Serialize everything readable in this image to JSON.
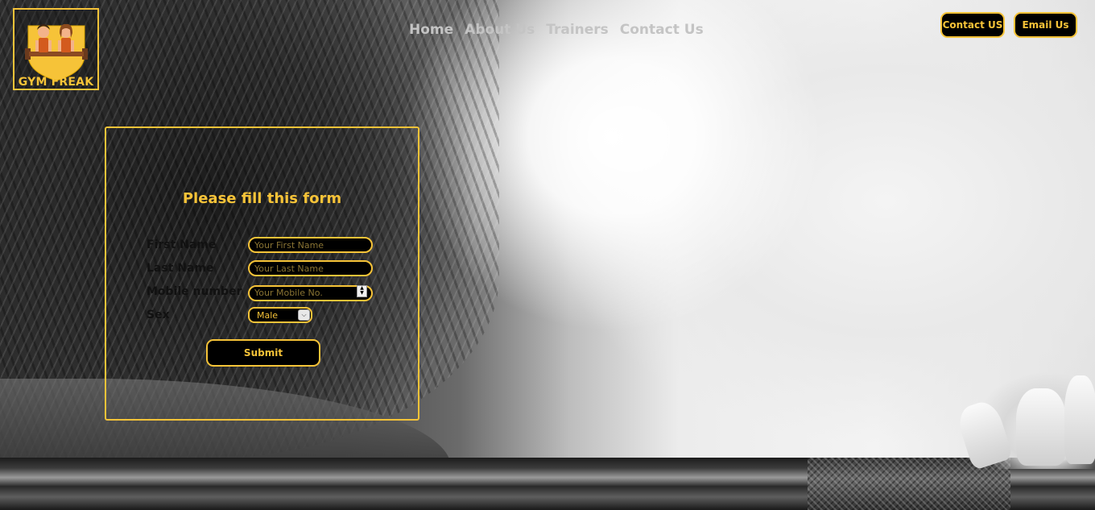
{
  "brand": {
    "name": "GYM FREAK",
    "logo_icon": "gym-couple-shield-icon",
    "accent_color": "#f6c338"
  },
  "nav": {
    "items": [
      {
        "label": "Home"
      },
      {
        "label": "About Us"
      },
      {
        "label": "Trainers"
      },
      {
        "label": "Contact Us"
      }
    ]
  },
  "header_buttons": {
    "contact_label": "Contact US",
    "email_label": "Email Us"
  },
  "form": {
    "title": "Please fill this form",
    "first_name": {
      "label": "First Name",
      "placeholder": "Your First Name",
      "value": ""
    },
    "last_name": {
      "label": "Last Name",
      "placeholder": "Your Last Name",
      "value": ""
    },
    "mobile": {
      "label": "Mobile number",
      "placeholder": "Your Mobile No.",
      "value": ""
    },
    "sex": {
      "label": "Sex",
      "selected": "Male"
    },
    "submit_label": "Submit"
  }
}
